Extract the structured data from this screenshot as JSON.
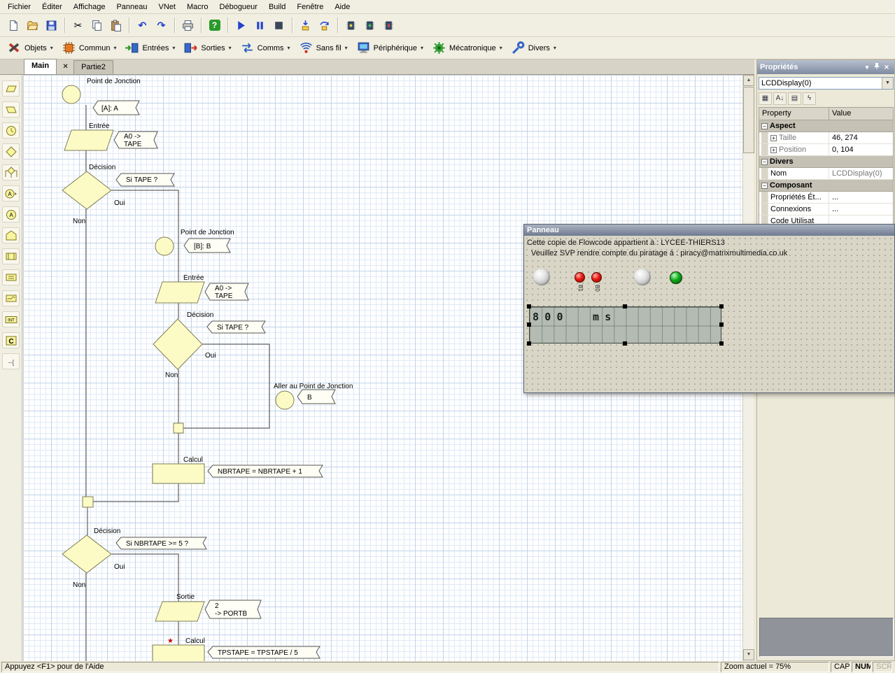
{
  "menu": {
    "items": [
      "Fichier",
      "Éditer",
      "Affichage",
      "Panneau",
      "VNet",
      "Macro",
      "Débogueur",
      "Build",
      "Fenêtre",
      "Aide"
    ]
  },
  "icons": {
    "cut": "✂",
    "undo": "↶",
    "redo": "↷",
    "help": "?",
    "titlebar_chevron": "▾",
    "titlebar_close": "✕",
    "tab_close": "✕",
    "combo_arrow": "▼",
    "dropdown_arrow": "▾",
    "scroll_up": "▲",
    "scroll_down": "▼",
    "expand_plus": "+",
    "collapse_minus": "−",
    "categorized": "▦",
    "sort_az": "A↓",
    "prop_page": "▤",
    "events": "ϟ",
    "tool_a": "A",
    "tool_int": "INT",
    "tool_c": "C",
    "tool_comment": "--[",
    "star": "★"
  },
  "components_bar": {
    "items": [
      "Objets",
      "Commun",
      "Entrées",
      "Sorties",
      "Comms",
      "Sans fil",
      "Périphérique",
      "Mécatronique",
      "Divers"
    ]
  },
  "tabs": {
    "main": "Main",
    "second": "Partie2"
  },
  "flowchart": {
    "junction_a": {
      "label": "Point de Jonction",
      "tag": "[A]: A"
    },
    "entree1": {
      "label": "Entrée",
      "tag_line1": "A0 ->",
      "tag_line2": "TAPE"
    },
    "decision1": {
      "label": "Décision",
      "tag": "Si TAPE ?",
      "yes": "Oui",
      "no": "Non"
    },
    "junction_b": {
      "label": "Point de Jonction",
      "tag": "[B]: B"
    },
    "entree2": {
      "label": "Entrée",
      "tag_line1": "A0 ->",
      "tag_line2": "TAPE"
    },
    "decision2": {
      "label": "Décision",
      "tag": "Si TAPE ?",
      "yes": "Oui",
      "no": "Non"
    },
    "goto_b": {
      "label": "Aller au Point de Jonction",
      "tag": "B"
    },
    "calcul1": {
      "label": "Calcul",
      "tag": "NBRTAPE = NBRTAPE + 1"
    },
    "decision3": {
      "label": "Décision",
      "tag": "Si NBRTAPE >= 5 ?",
      "yes": "Oui",
      "no": "Non"
    },
    "sortie1": {
      "label": "Sortie",
      "tag_line1": "2",
      "tag_line2": "-> PORTB"
    },
    "calcul2": {
      "label": "Calcul",
      "tag": "TPSTAPE = TPSTAPE / 5"
    }
  },
  "properties": {
    "title": "Propriétés",
    "combo_value": "LCDDisplay(0)",
    "col_property": "Property",
    "col_value": "Value",
    "cat1": "Aspect",
    "taille_label": "Taille",
    "taille_value": "46, 274",
    "position_label": "Position",
    "position_value": "0, 104",
    "cat2": "Divers",
    "nom_label": "Nom",
    "nom_value": "LCDDisplay(0)",
    "cat3": "Composant",
    "prop_et_label": "Propriétés Ét...",
    "prop_et_value": "...",
    "connexions_label": "Connexions",
    "connexions_value": "...",
    "code_label": "Code Utilisat",
    "code_value": ""
  },
  "panneau": {
    "title": "Panneau",
    "notice1": "Cette copie de Flowcode appartient à : LYCEE-THIERS13",
    "notice2": "Veuillez SVP rendre compte du piratage à : piracy@matrixmultimedia.co.uk",
    "led_label_b1": "B1",
    "led_label_b0": "B0",
    "lcd_digits": "800",
    "lcd_unit": "ms"
  },
  "statusbar": {
    "help": "Appuyez <F1> pour de l'Aide",
    "zoom": "Zoom actuel = 75%",
    "cap": "CAP",
    "num": "NUM",
    "scrl": "SCRL"
  }
}
